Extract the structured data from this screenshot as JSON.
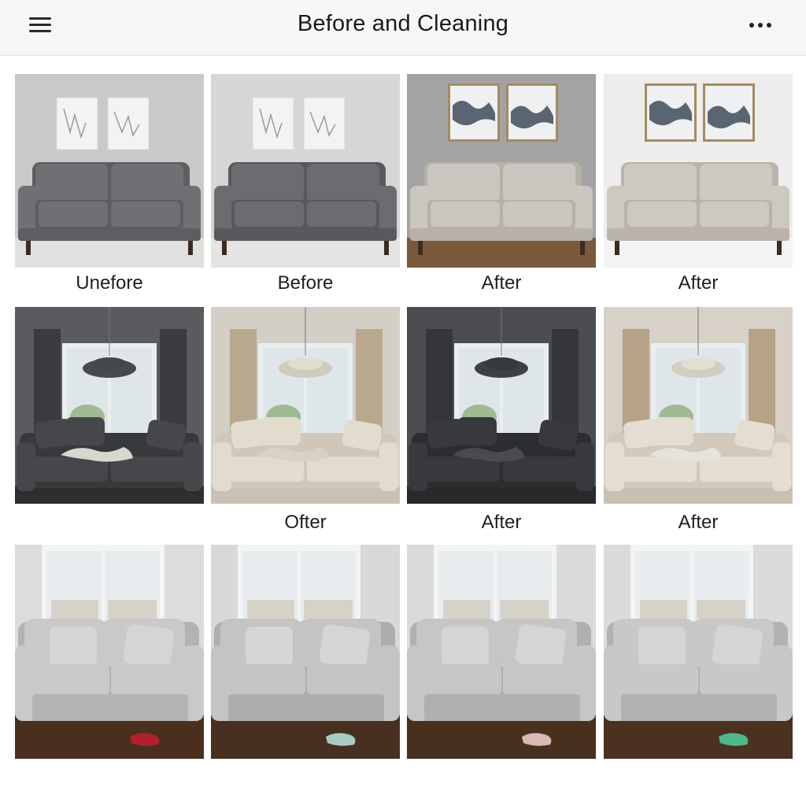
{
  "header": {
    "title": "Before and Cleaning",
    "menu_icon": "hamburger-menu-icon",
    "more_icon": "more-horizontal-icon"
  },
  "rows": [
    {
      "scene": "studio",
      "tiles": [
        {
          "caption": "Unefore",
          "wall": "#c9c9c8",
          "sofa": "#6f7073",
          "sofaDark": "#5d5e61",
          "art": "sketch",
          "floor": "#e0e0de"
        },
        {
          "caption": "Before",
          "wall": "#d6d6d4",
          "sofa": "#6b6c70",
          "sofaDark": "#58595d",
          "art": "sketch",
          "floor": "#e4e4e2"
        },
        {
          "caption": "After",
          "wall": "#a3a3a4",
          "sofa": "#cbc6bf",
          "sofaDark": "#b7b1a9",
          "art": "ink",
          "floor": "#7a5a3a"
        },
        {
          "caption": "After",
          "wall": "#ededed",
          "sofa": "#cdc8c0",
          "sofaDark": "#b9b3ab",
          "art": "ink",
          "floor": "#f4f4f4"
        }
      ]
    },
    {
      "scene": "window-curtains",
      "tiles": [
        {
          "caption": "",
          "wall": "#595b5e",
          "sofa": "#45474b",
          "sofaDark": "#37393c",
          "curtain": "#3a3b3e",
          "floor": "#2e2e2f",
          "clothes": "#d9d6cf"
        },
        {
          "caption": "Ofter",
          "wall": "#d3cec6",
          "sofa": "#e2dccf",
          "sofaDark": "#cfc8b9",
          "curtain": "#b9a88e",
          "floor": "#c9c1b4",
          "clothes": "#d8d2c6"
        },
        {
          "caption": "After",
          "wall": "#4c4d50",
          "sofa": "#38393c",
          "sofaDark": "#2c2d30",
          "curtain": "#353639",
          "floor": "#29292a",
          "clothes": "#4a4b4e"
        },
        {
          "caption": "After",
          "wall": "#d7d1c8",
          "sofa": "#e4ddd1",
          "sofaDark": "#d1c9bb",
          "curtain": "#b5a287",
          "floor": "#c9c0b2",
          "clothes": "#e6e2dc"
        }
      ]
    },
    {
      "scene": "window-rug",
      "tiles": [
        {
          "caption": "",
          "wall": "#dcdcdc",
          "sofa": "#c9c9c7",
          "sofaDark": "#b3b3b1",
          "floor": "#4a2f1f",
          "item": "#b1202e"
        },
        {
          "caption": "",
          "wall": "#d8d8d8",
          "sofa": "#c4c4c2",
          "sofaDark": "#aeaeac",
          "floor": "#47301f",
          "item": "#a8cbc3"
        },
        {
          "caption": "",
          "wall": "#dadada",
          "sofa": "#c6c6c4",
          "sofaDark": "#b0b0ae",
          "floor": "#48301f",
          "item": "#d9b8b6"
        },
        {
          "caption": "",
          "wall": "#dbdbdb",
          "sofa": "#c8c8c6",
          "sofaDark": "#b2b2b0",
          "floor": "#4a3120",
          "item": "#4db88c"
        }
      ]
    }
  ]
}
